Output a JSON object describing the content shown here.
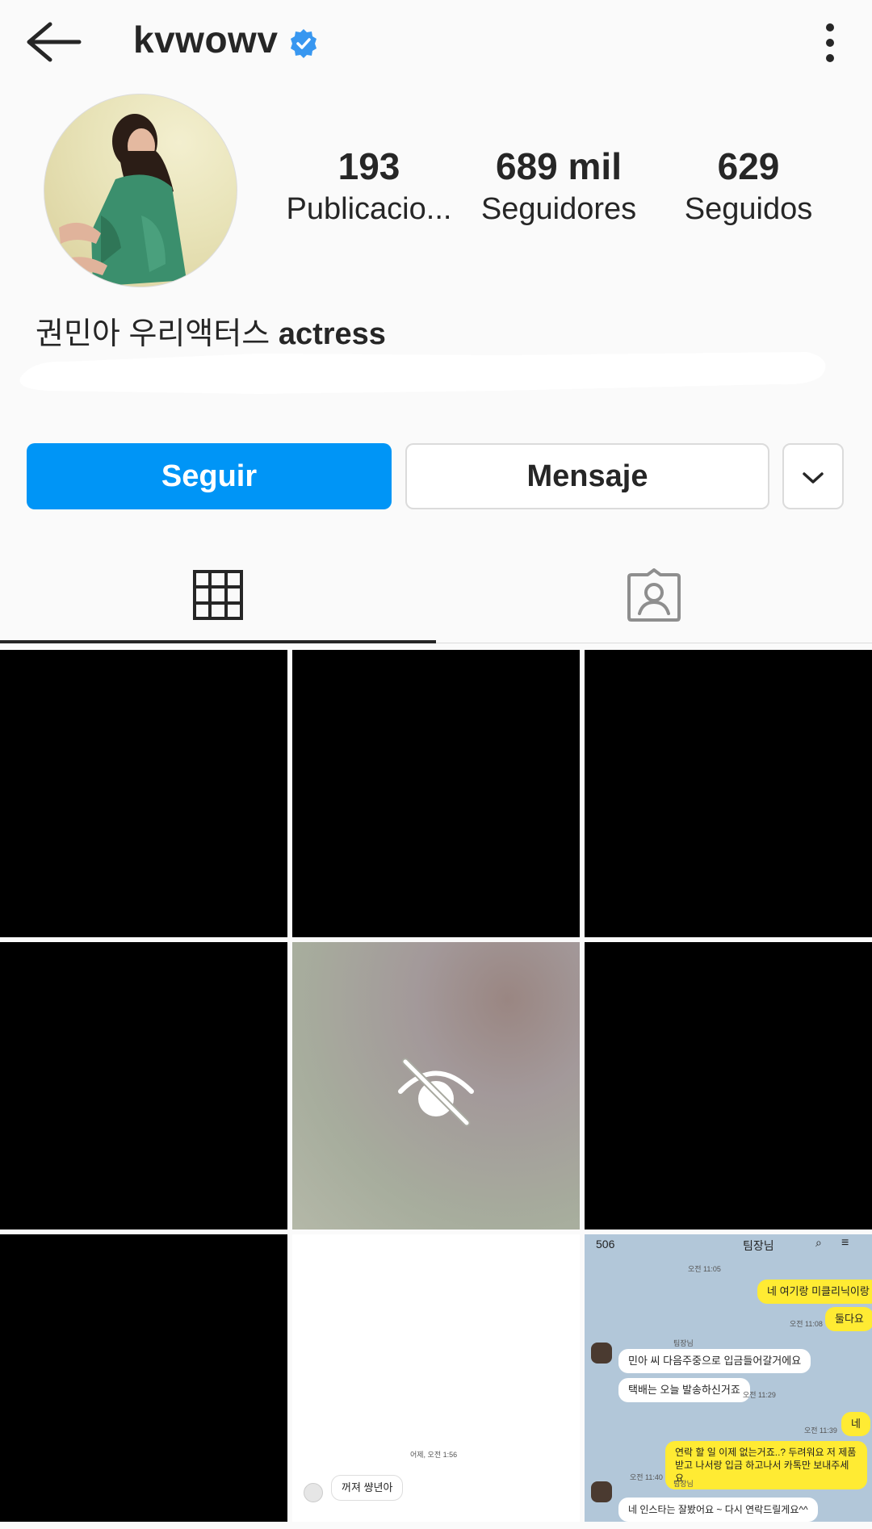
{
  "header": {
    "username": "kvwowv",
    "verified": true
  },
  "profile": {
    "stats": [
      {
        "value": "193",
        "label": "Publicacio..."
      },
      {
        "value": "689 mil",
        "label": "Seguidores"
      },
      {
        "value": "629",
        "label": "Seguidos"
      }
    ],
    "bio_korean": "권민아 우리액터스",
    "bio_english": "actress"
  },
  "actions": {
    "follow_label": "Seguir",
    "message_label": "Mensaje"
  },
  "colors": {
    "accent": "#0095f6",
    "background": "#fafafa",
    "text": "#262626"
  },
  "icons": {
    "back": "arrow-left-icon",
    "verified": "verified-badge-icon",
    "menu": "more-vertical-icon",
    "grid": "grid-icon",
    "tagged": "tagged-person-icon",
    "hidden": "eye-off-icon",
    "dropdown": "chevron-down-icon"
  },
  "grid": {
    "blank_chat": {
      "timestamp": "어제, 오전 1:56",
      "message": "꺼져 썅년아"
    },
    "chat": {
      "header_count": "506",
      "header_title": "팀장님",
      "messages": [
        {
          "text": "네 여기랑 미클리닉이랑",
          "time": ""
        },
        {
          "text": "둘다요",
          "time": "오전 11:08"
        },
        {
          "text": "민아 씨 다음주중으로 입금들어갈거에요",
          "time": ""
        },
        {
          "text": "택배는 오늘 발송하신거죠",
          "time": "오전 11:29"
        },
        {
          "text": "네",
          "time": "오전 11:39"
        },
        {
          "text": "연락 할 일 이제 없는거죠..? 두려워요 저 제품",
          "time": ""
        },
        {
          "text": "받고 나서랑 입금 하고나서 카톡만 보내주세요",
          "time": "오전 11:40"
        },
        {
          "text": "네 인스타는 잘봤어요 ~ 다시 연락드릴게요^^",
          "time": ""
        }
      ],
      "top_time": "오전 11:05",
      "sender_label": "팀장님"
    }
  }
}
